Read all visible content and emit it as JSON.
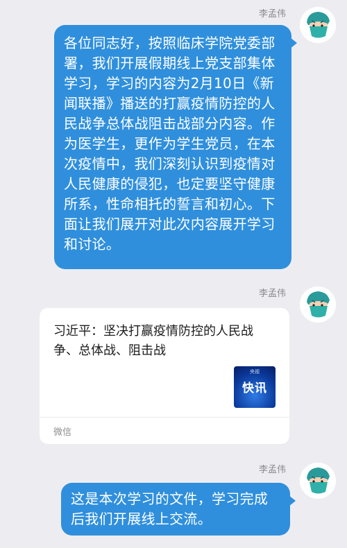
{
  "messages": [
    {
      "sender": "李孟伟",
      "text": "各位同志好，按照临床学院党委部署，我们开展假期线上党支部集体学习，学习的内容为2月10日《新闻联播》播送的打赢疫情防控的人民战争总体战阻击战部分内容。作为医学生，更作为学生党员，在本次疫情中，我们深刻认识到疫情对人民健康的侵犯，也定要坚守健康所系，性命相托的誓言和初心。下面让我们展开对此次内容展开学习和讨论。"
    },
    {
      "sender": "李孟伟",
      "card": {
        "title": "习近平：坚决打赢疫情防控的人民战争、总体战、阻击战",
        "thumb_top": "央视",
        "thumb_word": "快讯",
        "source": "微信"
      }
    },
    {
      "sender": "李孟伟",
      "text": "这是本次学习的文件，学习完成后我们开展线上交流。"
    }
  ],
  "avatar_icon": "nurse-avatar-icon",
  "colors": {
    "background": "#ededf1",
    "bubble": "#2f8fdc",
    "card": "#ffffff"
  }
}
